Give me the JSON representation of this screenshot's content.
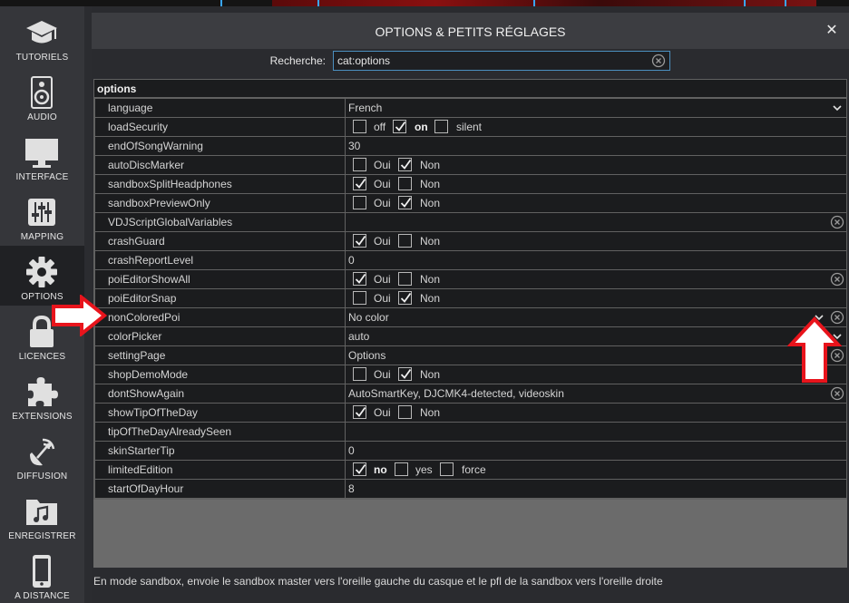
{
  "sidebar": {
    "items": [
      {
        "label": "TUTORIELS",
        "icon": "graduation-cap-icon",
        "active": false
      },
      {
        "label": "AUDIO",
        "icon": "speaker-icon",
        "active": false
      },
      {
        "label": "INTERFACE",
        "icon": "monitor-icon",
        "active": false
      },
      {
        "label": "MAPPING",
        "icon": "sliders-icon",
        "active": false
      },
      {
        "label": "OPTIONS",
        "icon": "gear-icon",
        "active": true
      },
      {
        "label": "LICENCES",
        "icon": "lock-icon",
        "active": false
      },
      {
        "label": "EXTENSIONS",
        "icon": "puzzle-icon",
        "active": false
      },
      {
        "label": "DIFFUSION",
        "icon": "broadcast-icon",
        "active": false
      },
      {
        "label": "ENREGISTRER",
        "icon": "music-folder-icon",
        "active": false
      },
      {
        "label": "A DISTANCE",
        "icon": "phone-icon",
        "active": false
      }
    ]
  },
  "dialog": {
    "title": "OPTIONS & PETITS RÉGLAGES",
    "close_label": "✕"
  },
  "search": {
    "label": "Recherche:",
    "value": "cat:options"
  },
  "table": {
    "section": "options",
    "rows": {
      "language": {
        "name": "language",
        "value": "French"
      },
      "loadSecurity": {
        "name": "loadSecurity",
        "opt1": "off",
        "opt2": "on",
        "opt3": "silent"
      },
      "endOfSongWarning": {
        "name": "endOfSongWarning",
        "value": "30"
      },
      "autoDiscMarker": {
        "name": "autoDiscMarker",
        "yes": "Oui",
        "no": "Non"
      },
      "sandboxSplitHeadphones": {
        "name": "sandboxSplitHeadphones",
        "yes": "Oui",
        "no": "Non"
      },
      "sandboxPreviewOnly": {
        "name": "sandboxPreviewOnly",
        "yes": "Oui",
        "no": "Non"
      },
      "VDJScriptGlobalVariables": {
        "name": "VDJScriptGlobalVariables",
        "value": ""
      },
      "crashGuard": {
        "name": "crashGuard",
        "yes": "Oui",
        "no": "Non"
      },
      "crashReportLevel": {
        "name": "crashReportLevel",
        "value": "0"
      },
      "poiEditorShowAll": {
        "name": "poiEditorShowAll",
        "yes": "Oui",
        "no": "Non"
      },
      "poiEditorSnap": {
        "name": "poiEditorSnap",
        "yes": "Oui",
        "no": "Non"
      },
      "nonColoredPoi": {
        "name": "nonColoredPoi",
        "value": "No color"
      },
      "colorPicker": {
        "name": "colorPicker",
        "value": "auto"
      },
      "settingPage": {
        "name": "settingPage",
        "value": "Options"
      },
      "shopDemoMode": {
        "name": "shopDemoMode",
        "yes": "Oui",
        "no": "Non"
      },
      "dontShowAgain": {
        "name": "dontShowAgain",
        "value": "AutoSmartKey, DJCMK4-detected, videoskin"
      },
      "showTipOfTheDay": {
        "name": "showTipOfTheDay",
        "yes": "Oui",
        "no": "Non"
      },
      "tipOfTheDayAlreadySeen": {
        "name": "tipOfTheDayAlreadySeen",
        "value": ""
      },
      "skinStarterTip": {
        "name": "skinStarterTip",
        "value": "0"
      },
      "limitedEdition": {
        "name": "limitedEdition",
        "opt1": "no",
        "opt2": "yes",
        "opt3": "force"
      },
      "startOfDayHour": {
        "name": "startOfDayHour",
        "value": "8"
      }
    }
  },
  "footer": {
    "description": "En mode sandbox, envoie le sandbox master vers l'oreille gauche du casque et le pfl de la sandbox vers l'oreille droite"
  },
  "colors": {
    "annotation_arrow": "#e8141c",
    "search_border": "#4b8fbf",
    "accent_blue": "#39a6ff"
  }
}
